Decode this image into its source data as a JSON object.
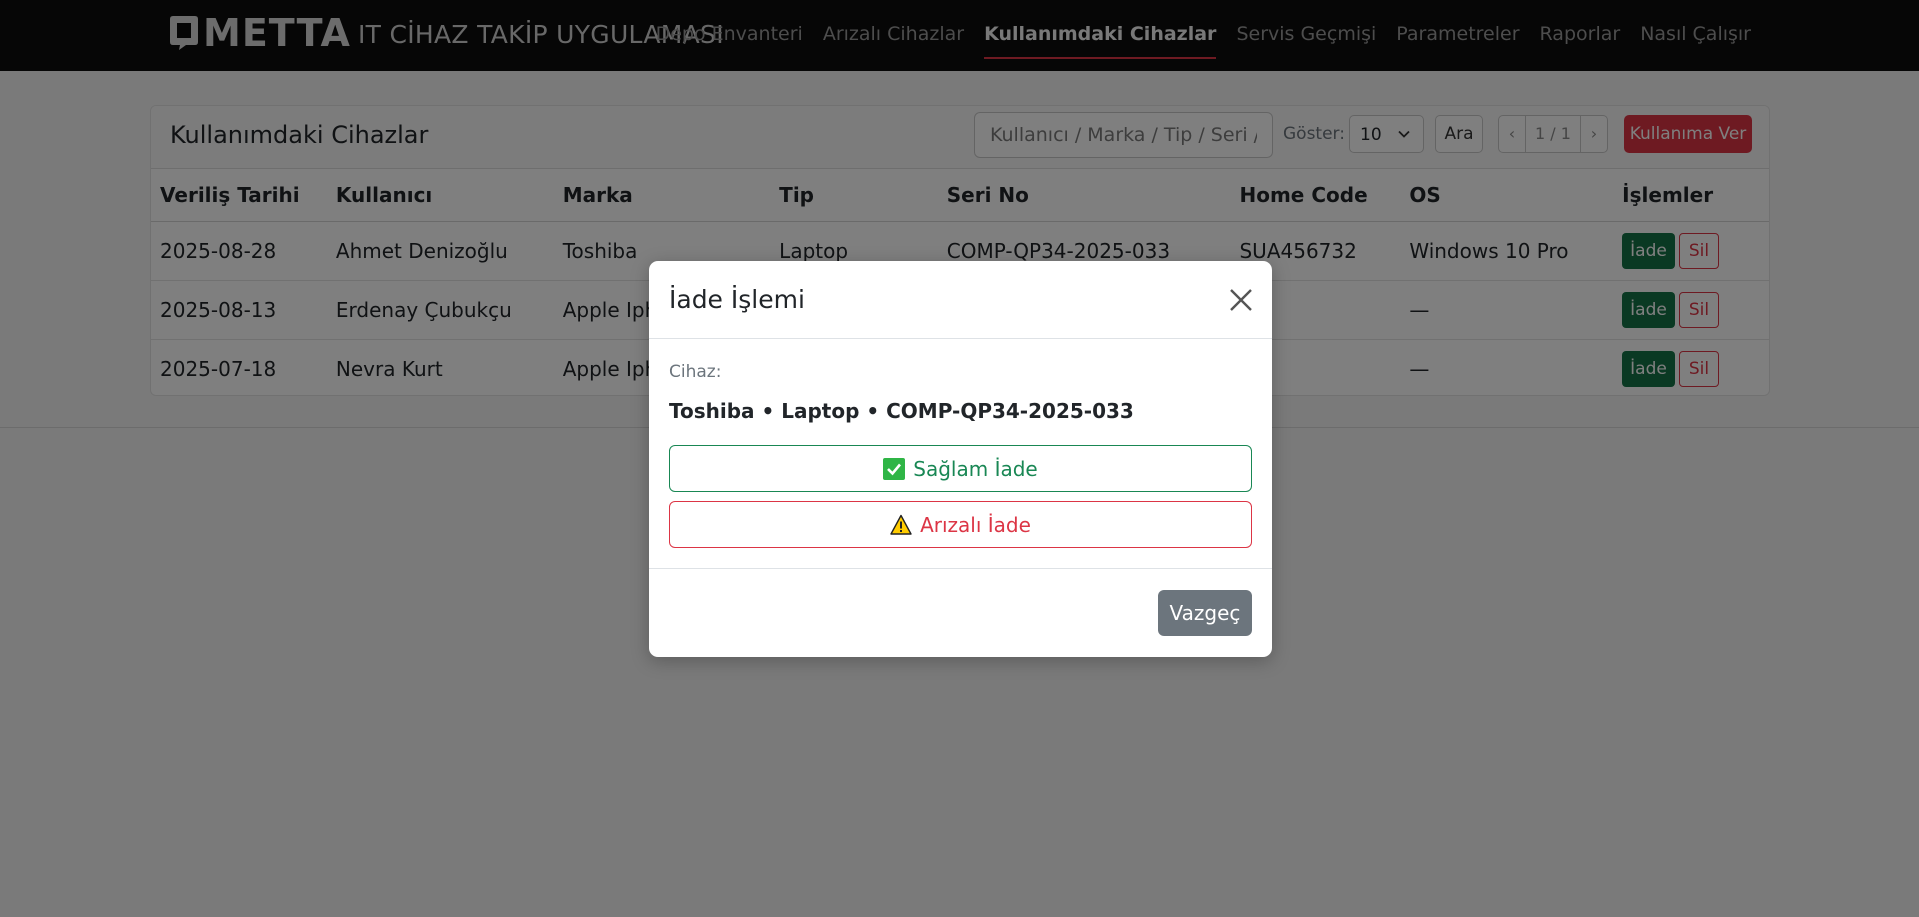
{
  "navbar": {
    "brand": "METTA",
    "app_title": "IT CİHAZ TAKİP UYGULAMASI",
    "links": [
      {
        "label": "Depo Envanteri",
        "active": false
      },
      {
        "label": "Arızalı Cihazlar",
        "active": false
      },
      {
        "label": "Kullanımdaki Cihazlar",
        "active": true
      },
      {
        "label": "Servis Geçmişi",
        "active": false
      },
      {
        "label": "Parametreler",
        "active": false
      },
      {
        "label": "Raporlar",
        "active": false
      },
      {
        "label": "Nasıl Çalışır",
        "active": false
      }
    ]
  },
  "card": {
    "title": "Kullanımdaki Cihazlar",
    "search_placeholder": "Kullanıcı / Marka / Tip / Seri / C",
    "show_label": "Göster:",
    "page_size": "10",
    "search_button": "Ara",
    "pager": {
      "prev": "‹",
      "info": "1 / 1",
      "next": "›"
    },
    "assign_button": "Kullanıma Ver"
  },
  "table": {
    "columns": [
      "Veriliş Tarihi",
      "Kullanıcı",
      "Marka",
      "Tip",
      "Seri No",
      "Home Code",
      "OS",
      "İşlemler"
    ],
    "rows": [
      {
        "date": "2025-08-28",
        "user": "Ahmet Denizoğlu",
        "brand": "Toshiba",
        "type": "Laptop",
        "serial": "COMP-QP34-2025-033",
        "home_code": "SUA456732",
        "os": "Windows 10 Pro"
      },
      {
        "date": "2025-08-13",
        "user": "Erdenay Çubukçu",
        "brand": "Apple Iph",
        "type": "",
        "serial": "",
        "home_code": "",
        "os": "—"
      },
      {
        "date": "2025-07-18",
        "user": "Nevra Kurt",
        "brand": "Apple Iph",
        "type": "",
        "serial": "",
        "home_code": "",
        "os": "—"
      }
    ],
    "return_label": "İade",
    "delete_label": "Sil"
  },
  "modal": {
    "title": "İade İşlemi",
    "device_label": "Cihaz:",
    "device_value": "Toshiba • Laptop • COMP-QP34-2025-033",
    "ok_return": "Sağlam İade",
    "faulty_return": "Arızalı İade",
    "cancel": "Vazgeç"
  },
  "colors": {
    "navbar_bg": "#0c0c0c",
    "danger": "#dc3545",
    "success": "#198754",
    "success_dark": "#157347",
    "secondary": "#6c757d"
  },
  "icons": {
    "close": "close-icon",
    "ok": "check-box-icon",
    "fault": "warning-icon",
    "page_size": "chevron-down-icon"
  }
}
